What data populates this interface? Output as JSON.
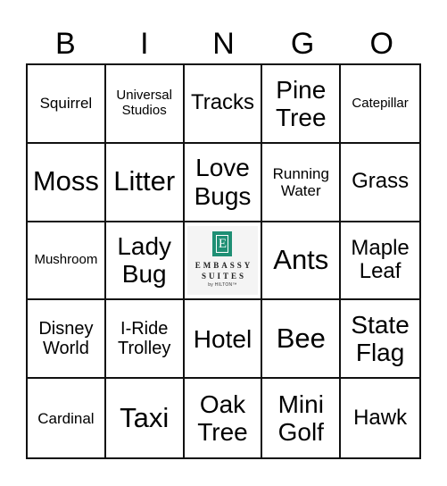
{
  "header": {
    "letters": [
      "B",
      "I",
      "N",
      "G",
      "O"
    ]
  },
  "free_space": {
    "logo_icon": "embassy-suites-e-icon",
    "logo_glyph": "E",
    "brand_color": "#1f8f74",
    "line1": "EMBASSY",
    "line2": "SUITES",
    "line3": "by HILTON™"
  },
  "cells": [
    [
      "Squirrel",
      "Universal Studios",
      "Tracks",
      "Pine Tree",
      "Catepillar"
    ],
    [
      "Moss",
      "Litter",
      "Love Bugs",
      "Running Water",
      "Grass"
    ],
    [
      "Mushroom",
      "Lady Bug",
      "",
      "Ants",
      "Maple Leaf"
    ],
    [
      "Disney World",
      "I-Ride Trolley",
      "Hotel",
      "Bee",
      "State Flag"
    ],
    [
      "Cardinal",
      "Taxi",
      "Oak Tree",
      "Mini Golf",
      "Hawk"
    ]
  ]
}
